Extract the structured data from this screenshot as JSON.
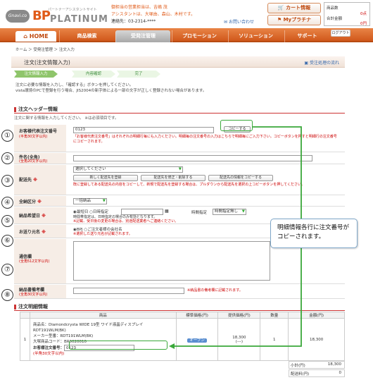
{
  "header": {
    "brand_mark": "Gnavi.co",
    "brand_bp": "BP",
    "brand_platinum": "PLATINUM",
    "brand_sub": "パートナーアシスタントサイト",
    "notice_line1": "御担当の営業担当は、吉嶋 茂",
    "notice_line2": "アシスタントは、大塚由、森山、木村です。",
    "notice_line3": "連絡先：03-2314-****",
    "support_link": "お問い合わせ",
    "cart_button": "カート情報",
    "myplatina_button": "Myプラチナ",
    "cart_count_label": "商品数",
    "cart_count_value": "0点",
    "cart_total_label": "合計金額",
    "cart_total_value": "0円",
    "logout_button": "ログアウト"
  },
  "nav": {
    "home": "HOME",
    "tabs": [
      "商品検索",
      "受発注管理",
      "プロモーション",
      "ソリューション",
      "サポート"
    ]
  },
  "breadcrumb": "ホーム ＞ 受発注管理 ＞ 注文入力",
  "page": {
    "title": "注文(注文情報入力)",
    "help": "受注処理の流れ"
  },
  "steps": [
    "注文情報入力",
    "内容確認",
    "完了"
  ],
  "intro": [
    "注文に必要な情報を入力し、「確認する」ボタンを押してください。",
    "vista環境のPCで登録を行う場合、JIS2004の新字体による一部の文字が正しく登録されない場合があります。"
  ],
  "header_section": {
    "title": "注文ヘッダー情報",
    "subtitle": "注文に関する情報を入力してください。 ※は必須項目です。"
  },
  "fields": {
    "order_no": {
      "label": "お客様代表注文番号",
      "sub": "(半角30文字以内)",
      "value": "0123",
      "copy_button": "コピーする",
      "note": "「お客様代表注文番号」はそれぞれの明細行毎にも入力ください。明細毎の注文番号の入力はこちらで明細毎にご入力下さい。コピーボタンを押すと明細行の注文番号にコピーされます。"
    },
    "subject": {
      "label": "件名(全角)",
      "sub": "(全角20文字以内)",
      "value": ""
    },
    "delivery": {
      "label": "配送先",
      "required": "※",
      "select": "選択してください",
      "btn1": "新しく配送先を登録",
      "btn2": "配送先を修正・削除する",
      "btn3": "配送先の情報をコピーする",
      "note": "既に登録してある配送先の内容をコピーして、新規で配送先を登録する場合は、プルダウンから配送先を選択の上コピーボタンを押してください。"
    },
    "delivery_type": {
      "label": "全納区分",
      "required": "※",
      "value": "一括納品"
    },
    "date": {
      "label": "納品希望日",
      "required": "※",
      "opt1": "最短日",
      "opt2": "日時指定",
      "time_label": "時間指定",
      "time_value": "時間指定無し",
      "note1": "時間帯指定は、日時指定の場合のみ有効となります。",
      "note2": "※記載、受日後の変更の場合は、別途配送業者へご連絡ください。"
    },
    "sender": {
      "label": "お送り元名",
      "required": "※",
      "opt1": "BPJ",
      "opt2": "ご注文者様の会社名",
      "note": "※選択した送り元名が記載されます。"
    },
    "remarks": {
      "label": "通信欄",
      "sub": "(全角512文字以内)"
    },
    "customer_note": {
      "label": "納品書備考欄",
      "sub": "(全角30文字以内)",
      "note": "※納品書の備考欄に記載されます。"
    }
  },
  "callout": "明細情報各行に注文番号がコピーされます。",
  "detail_section": {
    "title": "注文明細情報",
    "columns": [
      "",
      "商品",
      "標準価格(円)",
      "提供価格(円)",
      "数量",
      "金額(円)"
    ],
    "row": {
      "no": "1",
      "product_name": "商品名：Diamondcrysta WIDE 19型 ワイド液晶ディスプレイ RDT191WLM(BK)",
      "maker": "メーカー型番：RDT191WLM(BK)",
      "code": "大塚商品コード：BR0020010",
      "order_label": "お客様注文番号：",
      "order_value": "0123",
      "order_sub": "(半角30文字以内)",
      "std_price": "オープン",
      "price": "18,300",
      "price_sub": "(---)",
      "qty": "1",
      "amount": "18,300"
    },
    "subtotal_label": "小計(円)",
    "subtotal": "18,300",
    "shipping_label": "配送料(円)",
    "shipping": "0"
  },
  "numbers": [
    "①",
    "②",
    "③",
    "④",
    "⑤",
    "⑥",
    "⑦",
    "⑧"
  ]
}
